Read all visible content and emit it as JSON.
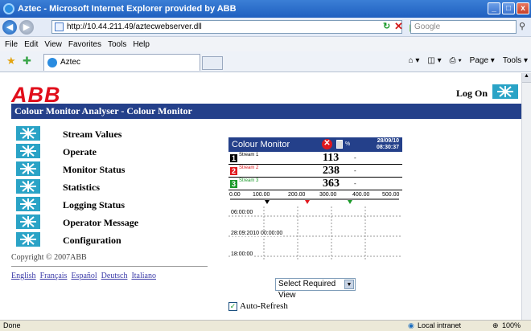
{
  "window": {
    "title": "Aztec - Microsoft Internet Explorer provided by ABB",
    "minimize": "_",
    "maximize": "□",
    "close": "x"
  },
  "toolbar": {
    "address": "http://10.44.211.49/aztecwebserver.dll",
    "search_placeholder": "Google"
  },
  "menu": {
    "items": [
      "File",
      "Edit",
      "View",
      "Favorites",
      "Tools",
      "Help"
    ]
  },
  "favbar": {
    "tab_label": "Aztec",
    "page_label": "Page",
    "tools_label": "Tools"
  },
  "page": {
    "logo": "ABB",
    "logon": "Log On",
    "banner": "Colour Monitor Analyser - Colour Monitor",
    "nav": [
      "Stream Values",
      "Operate",
      "Monitor Status",
      "Statistics",
      "Logging Status",
      "Operator Message",
      "Configuration"
    ],
    "copyright": "Copyright © 2007ABB",
    "languages": [
      "English",
      "Français",
      "Español",
      "Deutsch",
      "Italiano"
    ],
    "select_view": "Select Required View",
    "auto_refresh": "Auto-Refresh"
  },
  "monitor": {
    "title": "Colour Monitor",
    "date": "28/09/10",
    "time": "08:30:37",
    "disk_pct": "%",
    "streams": [
      {
        "num": "1",
        "name": "Stream 1",
        "value": "113",
        "unit": "-",
        "color": "#000000",
        "label_color": "#000000"
      },
      {
        "num": "2",
        "name": "Stream 2",
        "value": "238",
        "unit": "-",
        "color": "#e0181e",
        "label_color": "#e0181e"
      },
      {
        "num": "3",
        "name": "Stream 3",
        "value": "363",
        "unit": "-",
        "color": "#1c9a2b",
        "label_color": "#1c9a2b"
      }
    ],
    "scale": [
      "0.00",
      "100.00",
      "200.00",
      "300.00",
      "400.00",
      "500.00"
    ],
    "trend_times": [
      "06:00:00",
      "28:09:2010  00:00:00",
      "18:00:00"
    ]
  },
  "status": {
    "left": "Done",
    "zone": "Local intranet",
    "zoom": "100%"
  }
}
